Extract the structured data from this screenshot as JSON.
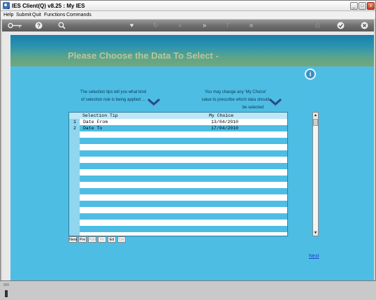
{
  "window": {
    "title": "IES Client(Q) v8.25 : My IES",
    "controls": {
      "minimize": "_",
      "maximize": "□",
      "close": "x"
    }
  },
  "menu": [
    "Help",
    "Submit",
    "Quit",
    "Functions",
    "Commands"
  ],
  "toolbar": {
    "icons": [
      "key-icon",
      "help-icon",
      "search-icon",
      "heart-icon",
      "refresh-icon",
      "rewind-icon",
      "fast-forward-icon",
      "filter-icon",
      "stop-icon",
      "print-icon",
      "ok-icon",
      "close-icon"
    ]
  },
  "page": {
    "heading": "Please Choose the Data To Select -",
    "info_label": "i",
    "tip_left": "The selection tips tell you what kind of selection rule is being applied ...",
    "tip_left_line1": "The selection tips tell you what kind",
    "tip_left_line2": "of selection rule is being applied ...",
    "tip_right_line1": "You may change any 'My Choice'",
    "tip_right_line2": "value to prescribe which data should",
    "tip_right_line3": "be selected",
    "next_link": "Next"
  },
  "grid": {
    "columns": [
      "Selection Tip",
      "My Choice"
    ],
    "rows": [
      {
        "num": "1",
        "tip": "Date From",
        "choice": "13/04/2010"
      },
      {
        "num": "2",
        "tip": "Date To",
        "choice": "17/04/2010"
      }
    ],
    "buttons": [
      {
        "label": "New",
        "enabled": true
      },
      {
        "label": "Pre",
        "enabled": true
      },
      {
        "label": "Add",
        "enabled": false
      },
      {
        "label": "Fir",
        "enabled": false
      },
      {
        "label": "Ed",
        "enabled": true
      },
      {
        "label": "Del",
        "enabled": false
      }
    ]
  },
  "colors": {
    "panel": "#4dbde4",
    "heading": "#b9c69a",
    "link": "#1b3fcc"
  }
}
